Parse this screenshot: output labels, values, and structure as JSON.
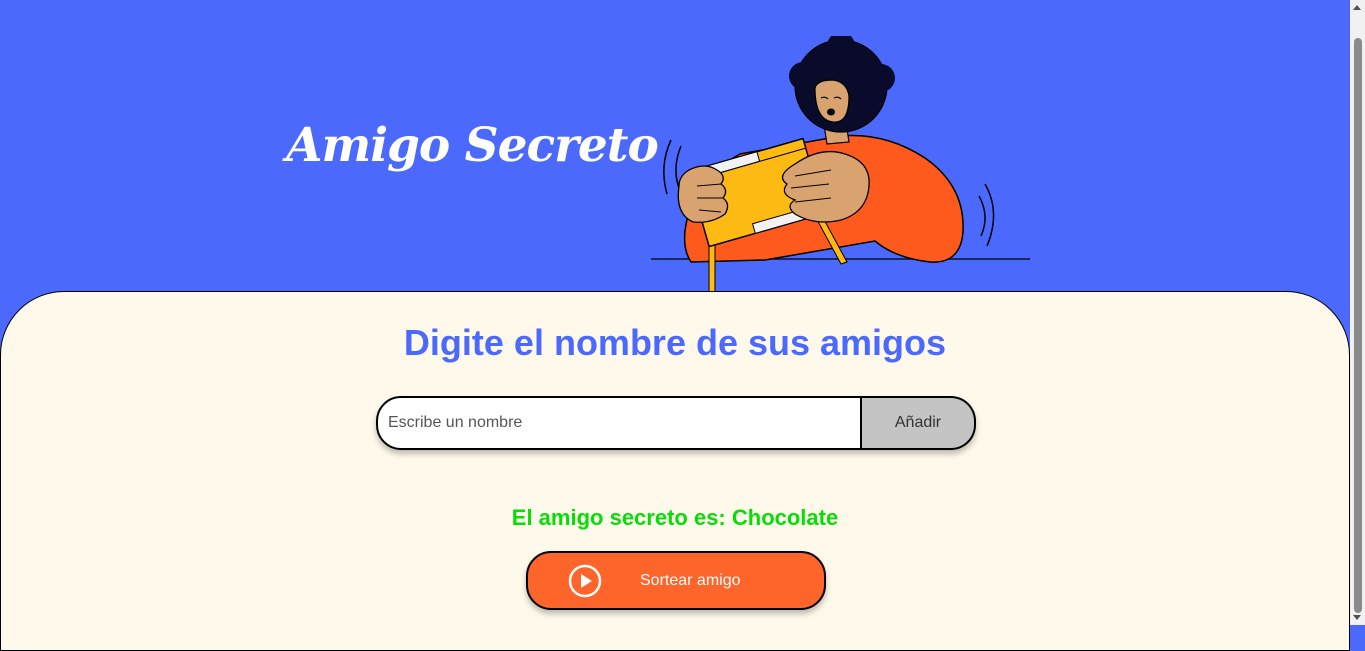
{
  "header": {
    "title": "Amigo Secreto"
  },
  "main": {
    "subtitle": "Digite el nombre de sus amigos",
    "input": {
      "placeholder": "Escribe un nombre",
      "value": ""
    },
    "add_button_label": "Añadir",
    "result_text": "El amigo secreto es: Chocolate",
    "draw_button_label": "Sortear amigo"
  },
  "icons": {
    "illustration": "person-shaking-gift-box",
    "draw_button_icon": "play-circle-icon"
  },
  "colors": {
    "header_bg": "#4B69FD",
    "main_bg": "#FFF9EB",
    "subtitle": "#4B69FD",
    "result": "#05DF05",
    "draw_button": "#FE652B",
    "add_button": "#C4C4C4"
  }
}
